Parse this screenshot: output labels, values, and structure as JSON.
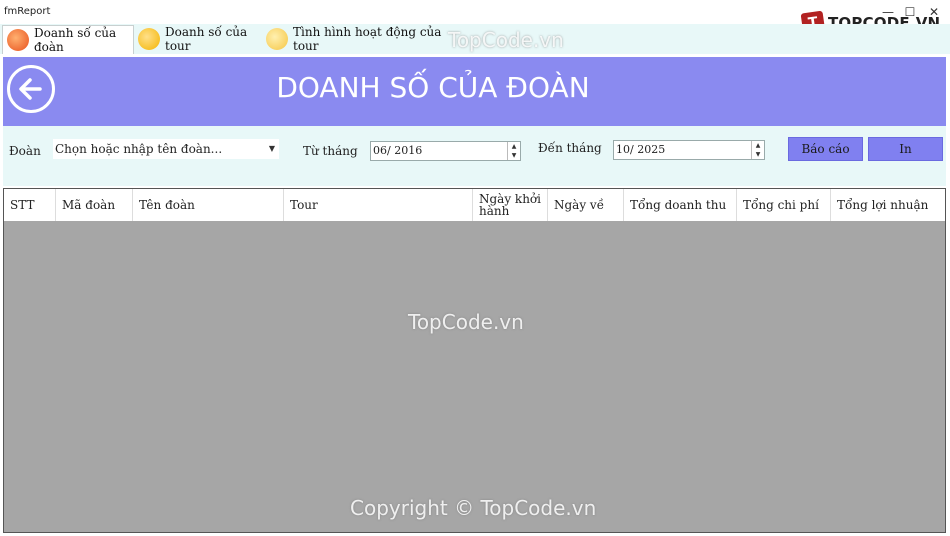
{
  "window": {
    "title": "fmReport",
    "minimize_glyph": "—",
    "maximize_glyph": "☐",
    "close_glyph": "✕"
  },
  "brand": {
    "logo_text": "TOPCODE.VN",
    "logo_mark_glyph": "T",
    "watermark_top": "TopCode.vn",
    "watermark_center": "TopCode.vn",
    "watermark_bottom": "Copyright © TopCode.vn"
  },
  "tabs": [
    {
      "label": "Doanh số của đoàn",
      "icon": "chart-icon"
    },
    {
      "label": "Doanh số của tour",
      "icon": "coin-icon"
    },
    {
      "label": "Tình hình hoạt động của tour",
      "icon": "sun-icon"
    }
  ],
  "header": {
    "title": "DOANH SỐ CỦA ĐOÀN",
    "back_icon": "arrow-left-icon"
  },
  "filters": {
    "doan_label": "Đoàn",
    "doan_placeholder": "Chọn hoặc nhập tên đoàn...",
    "from_label": "Từ tháng",
    "from_value": "06/ 2016",
    "to_label": "Đến tháng",
    "to_value": "10/ 2025",
    "report_button": "Báo cáo",
    "print_button": "In"
  },
  "table": {
    "columns": [
      "STT",
      "Mã đoàn",
      "Tên đoàn",
      "Tour",
      "Ngày khởi hành",
      "Ngày về",
      "Tổng doanh thu",
      "Tổng chi phí",
      "Tổng lợi nhuận"
    ],
    "rows": []
  },
  "colors": {
    "header_bg": "#8a8af0",
    "panel_bg": "#e8f8f8",
    "button_bg": "#8080f0",
    "grid_bg": "#a6a6a6"
  }
}
